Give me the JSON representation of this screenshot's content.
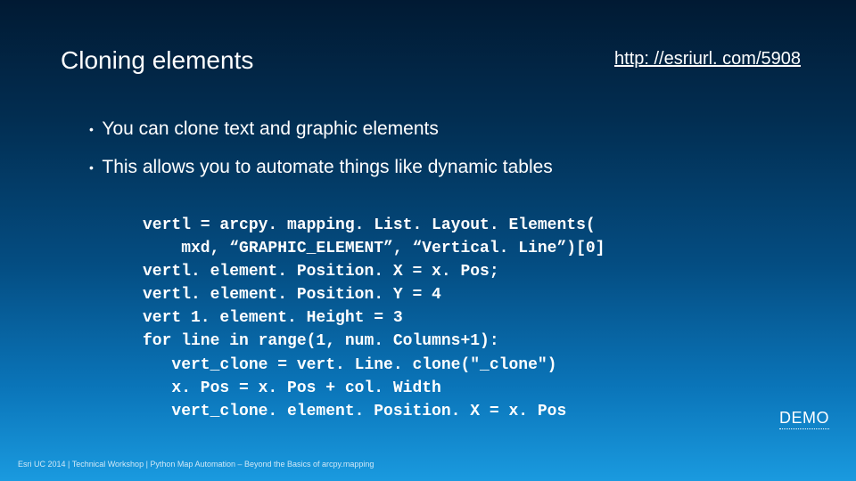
{
  "title": "Cloning elements",
  "url": "http: //esriurl. com/5908",
  "bullets": [
    "You can clone text and graphic elements",
    "This allows you to automate things like dynamic tables"
  ],
  "code": "vertl = arcpy. mapping. List. Layout. Elements(\n    mxd, “GRAPHIC_ELEMENT”, “Vertical. Line”)[0]\nvertl. element. Position. X = x. Pos;\nvertl. element. Position. Y = 4\nvert 1. element. Height = 3\nfor line in range(1, num. Columns+1):\n   vert_clone = vert. Line. clone(\"_clone\")\n   x. Pos = x. Pos + col. Width\n   vert_clone. element. Position. X = x. Pos",
  "demo_label": "DEMO",
  "footer": "Esri UC 2014 | Technical Workshop |  Python Map Automation – Beyond the Basics of arcpy.mapping"
}
